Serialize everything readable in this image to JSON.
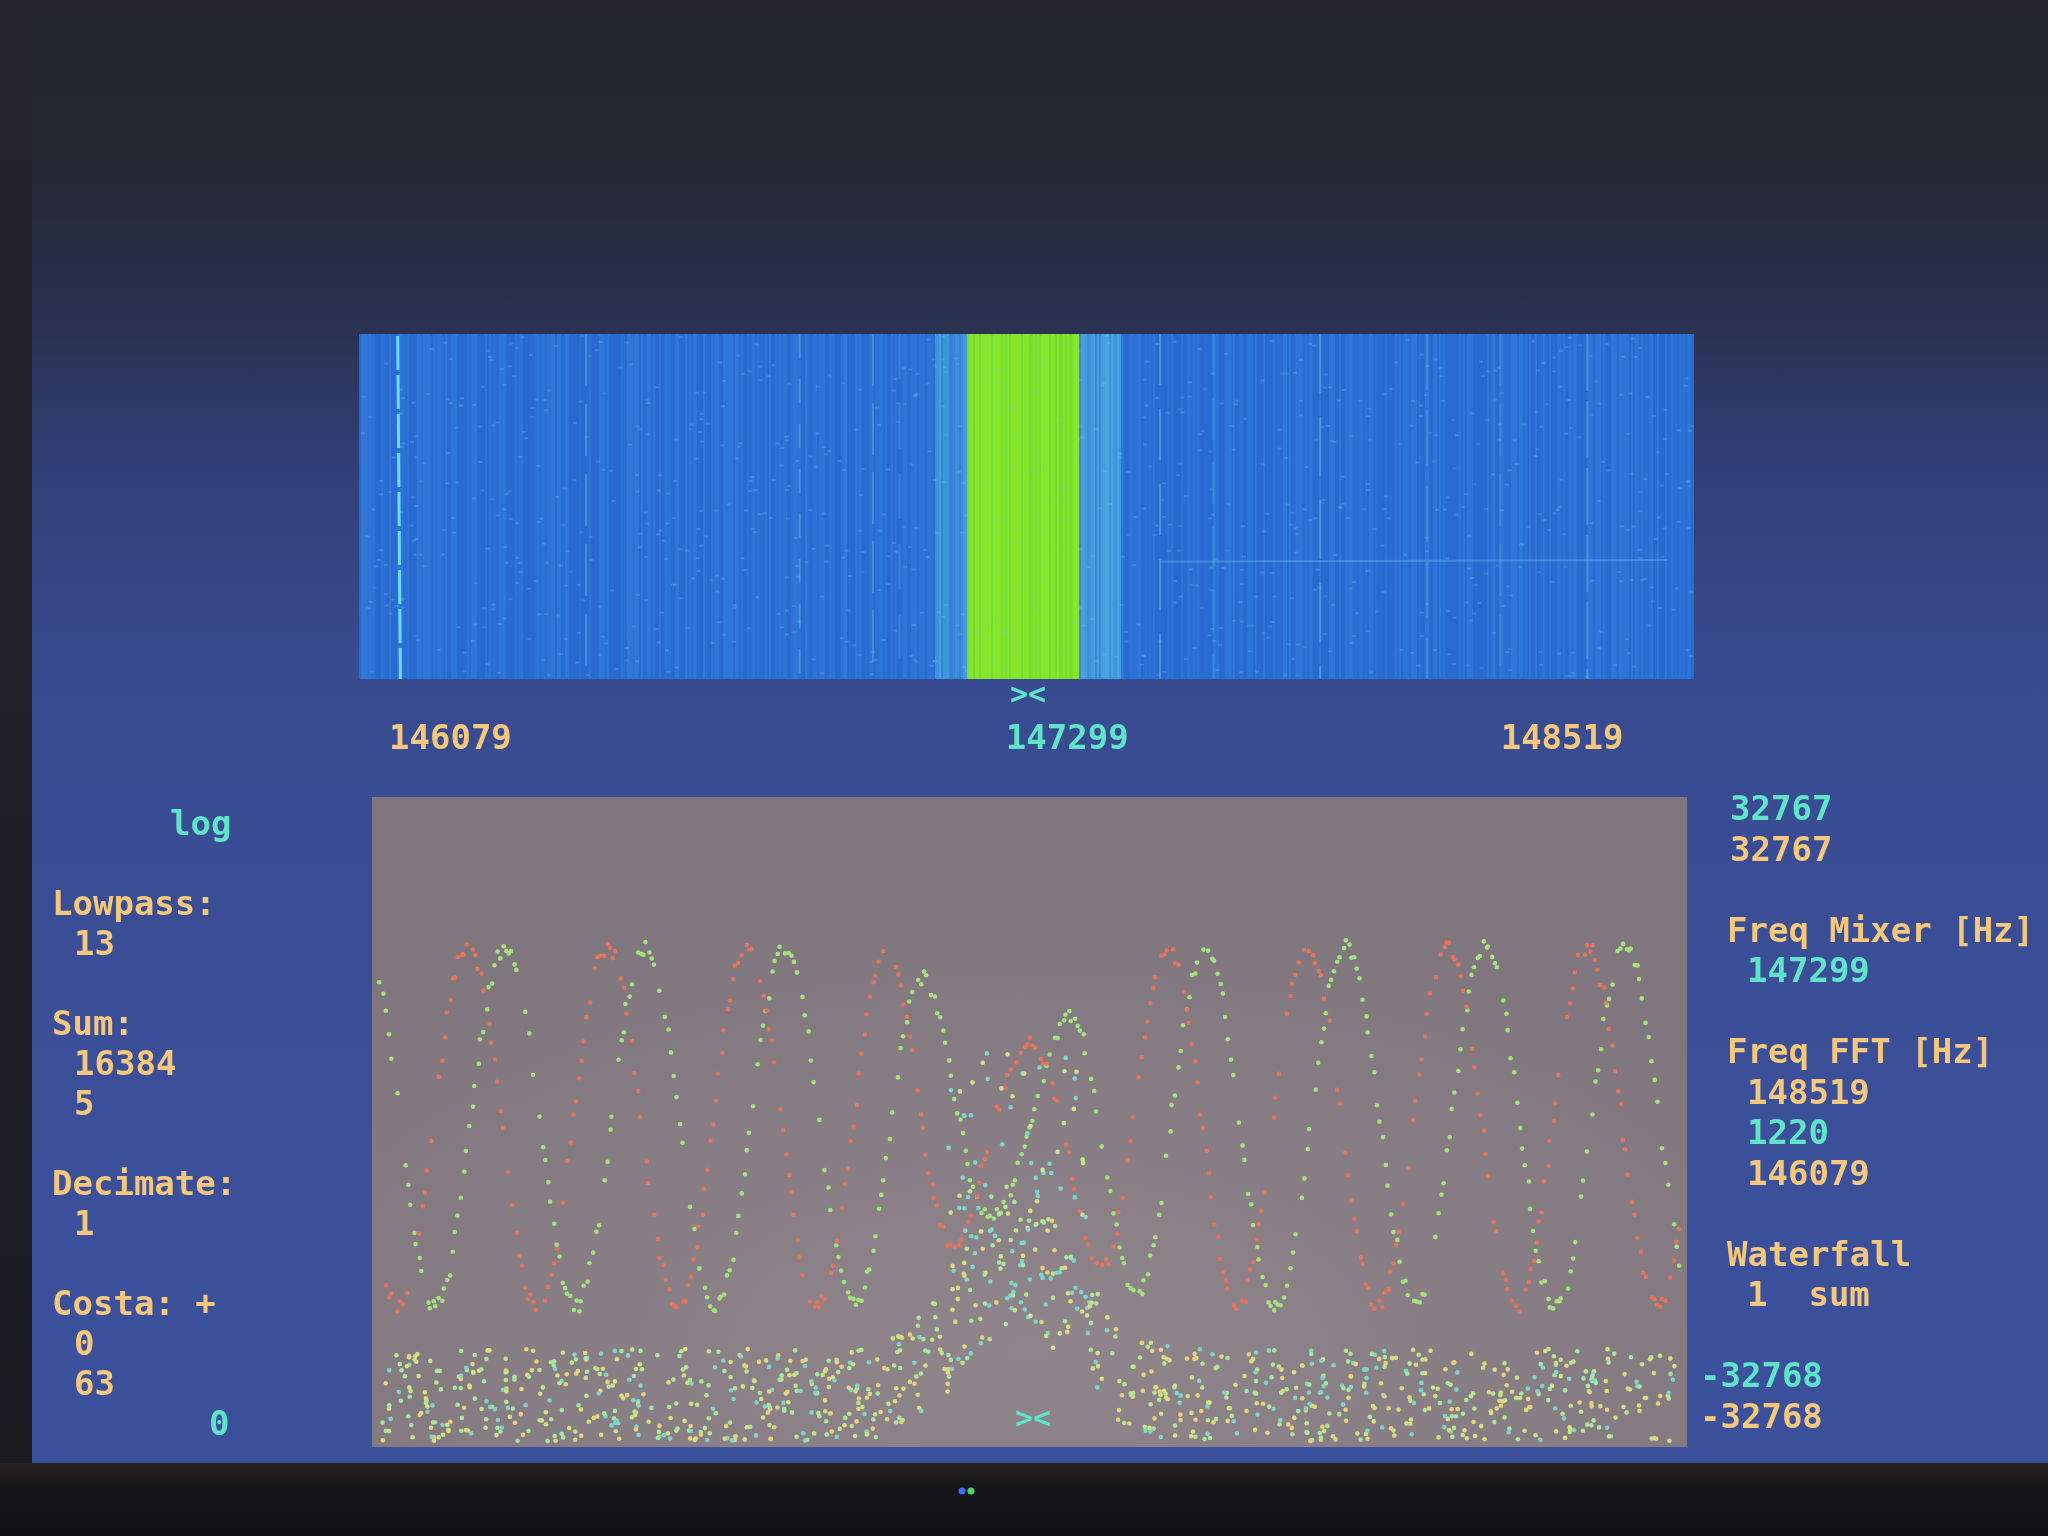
{
  "waterfall": {
    "marker": "><",
    "freq_labels": [
      {
        "text": "146079",
        "color": "#f3c77c"
      },
      {
        "text": "147299",
        "color": "#5fe3c9"
      },
      {
        "text": "148519",
        "color": "#f3c77c"
      }
    ]
  },
  "left_panel": {
    "mode": "log",
    "groups": [
      {
        "label": "Lowpass:",
        "values": [
          "13"
        ]
      },
      {
        "label": "Sum:",
        "values": [
          "16384",
          "5"
        ]
      },
      {
        "label": "Decimate:",
        "values": [
          "1"
        ]
      },
      {
        "label": "Costa: +",
        "values": [
          "0",
          "63"
        ]
      }
    ],
    "footer": "0"
  },
  "scope": {
    "marker": "><"
  },
  "right_panel": {
    "top_values": [
      {
        "text": "32767",
        "color": "#5fe3c9"
      },
      {
        "text": "32767",
        "color": "#f3c77c"
      }
    ],
    "groups": [
      {
        "label": "Freq Mixer [Hz]",
        "values": [
          {
            "text": "147299",
            "color": "#5fe3c9"
          }
        ]
      },
      {
        "label": "Freq FFT [Hz]",
        "values": [
          {
            "text": "148519",
            "color": "#f3c77c"
          },
          {
            "text": "1220",
            "color": "#5fe3c9"
          },
          {
            "text": "146079",
            "color": "#f3c77c"
          }
        ]
      },
      {
        "label": "Waterfall",
        "values": [
          {
            "text": "1  sum",
            "color": "#f3c77c"
          }
        ]
      }
    ],
    "bottom_values": [
      {
        "text": "-32768",
        "color": "#5fe3c9"
      },
      {
        "text": "-32768",
        "color": "#f3c77c"
      }
    ]
  }
}
